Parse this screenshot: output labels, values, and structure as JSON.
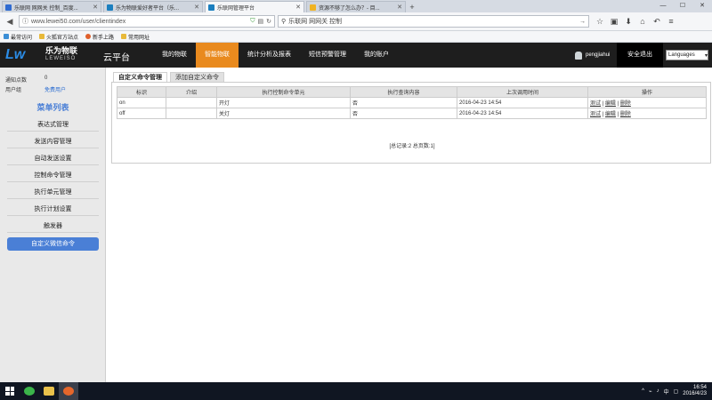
{
  "browser": {
    "tabs": [
      {
        "title": "乐联网 网网关 控制_百度...",
        "active": false
      },
      {
        "title": "乐为物联爱好者平台（乐...",
        "active": false
      },
      {
        "title": "乐联网管理平台",
        "active": true
      },
      {
        "title": "资源不够了怎么办？- 目...",
        "active": false
      }
    ],
    "new_tab": "+",
    "url": "www.lewei50.com/user/clientindex",
    "search_value": "乐联网 网网关 控制",
    "bookmarks": [
      "最常访问",
      "火狐官方站点",
      "新手上路",
      "常用网址"
    ]
  },
  "site": {
    "logo_cn": "乐为物联",
    "logo_en": "LEWEISO",
    "logo_mark": "Lw",
    "cloud_label": "云平台",
    "nav": [
      {
        "label": "我的物联",
        "active": false
      },
      {
        "label": "智能物联",
        "active": true
      },
      {
        "label": "统计分析及报表",
        "active": false
      },
      {
        "label": "短信预警管理",
        "active": false
      },
      {
        "label": "我的账户",
        "active": false
      }
    ],
    "username": "pengjiahui",
    "logout_label": "安全退出",
    "language_label": "Languages"
  },
  "sidebar": {
    "info": [
      {
        "label": "通知点数",
        "value": "0",
        "highlight": false
      },
      {
        "label": "用户组",
        "value": "免费用户",
        "highlight": true
      }
    ],
    "menu_title": "菜单列表",
    "items": [
      {
        "label": "表达式管理",
        "active": false
      },
      {
        "label": "发送内容管理",
        "active": false
      },
      {
        "label": "自动发送设置",
        "active": false
      },
      {
        "label": "控制命令管理",
        "active": false
      },
      {
        "label": "执行单元管理",
        "active": false
      },
      {
        "label": "执行计划设置",
        "active": false
      },
      {
        "label": "触发器",
        "active": false
      },
      {
        "label": "自定义微信命令",
        "active": true
      }
    ]
  },
  "main": {
    "tabs": [
      {
        "label": "自定义命令管理",
        "active": true
      },
      {
        "label": "添加自定义命令",
        "active": false
      }
    ],
    "table": {
      "headers": [
        "标识",
        "介绍",
        "执行控制命令单元",
        "执行查询内容",
        "上次调用时间",
        "操作"
      ],
      "rows": [
        {
          "id": "on",
          "intro": "",
          "unit": "开灯",
          "query": "否",
          "last_call": "2016-04-23 14:54",
          "actions": [
            "测试",
            "编辑",
            "删除"
          ]
        },
        {
          "id": "off",
          "intro": "",
          "unit": "关灯",
          "query": "否",
          "last_call": "2016-04-23 14:54",
          "actions": [
            "测试",
            "编辑",
            "删除"
          ]
        }
      ]
    },
    "pager": "[总记录:2 总页数:1]"
  },
  "taskbar": {
    "time": "16:54",
    "date": "2016/4/23",
    "ime": "中"
  }
}
